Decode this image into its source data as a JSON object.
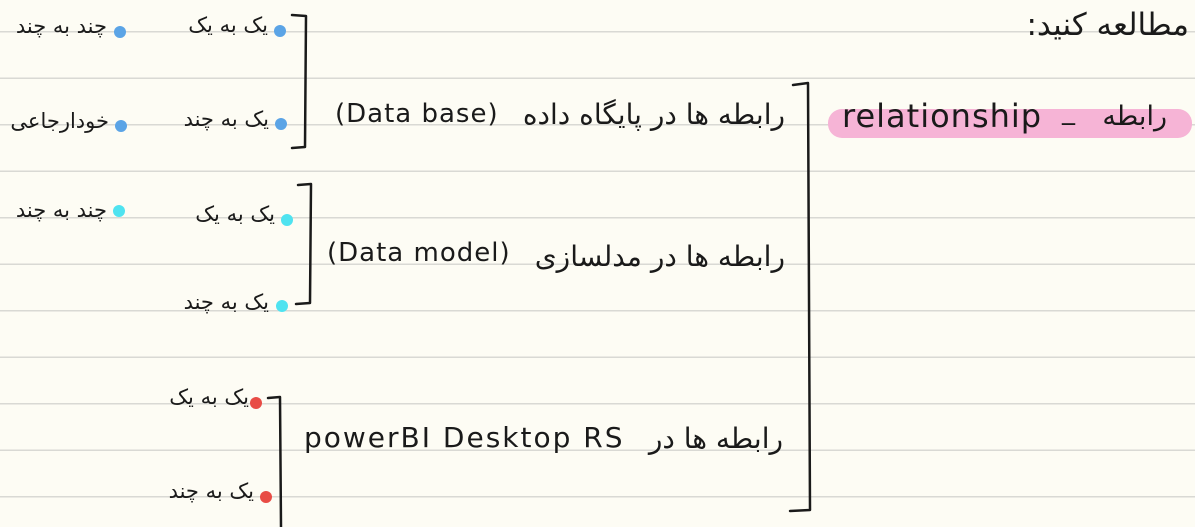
{
  "header": {
    "instruction": "مطالعه کنید:"
  },
  "highlight": {
    "english": "relationship",
    "separator": "_",
    "persian": "رابطه"
  },
  "groups": [
    {
      "title_fa": "رابطه ها در پایگاه داده",
      "title_en": "(Data base)",
      "items": [
        {
          "label": "یک به یک",
          "color": "#5ba4e6"
        },
        {
          "label": "یک به چند",
          "color": "#5ba4e6"
        }
      ],
      "extras": [
        {
          "label": "چند به چند",
          "color": "#5ba4e6"
        },
        {
          "label": "خودارجاعی",
          "color": "#5ba4e6"
        }
      ]
    },
    {
      "title_fa": "رابطه ها در مدلسازی",
      "title_en": "(Data model)",
      "items": [
        {
          "label": "یک به یک",
          "color": "#4fe3f0"
        },
        {
          "label": "یک به چند",
          "color": "#4fe3f0"
        }
      ],
      "extras": [
        {
          "label": "چند به چند",
          "color": "#4fe3f0"
        }
      ]
    },
    {
      "title_fa": "رابطه ها در",
      "title_en": "powerBI Desktop RS",
      "items": [
        {
          "label": "یک به یک",
          "color": "#e84c45"
        },
        {
          "label": "یک به چند",
          "color": "#e84c45"
        }
      ]
    }
  ]
}
